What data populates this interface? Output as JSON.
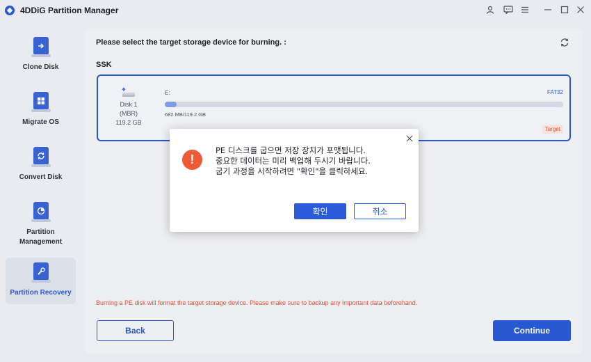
{
  "app": {
    "title": "4DDiG Partition Manager",
    "accent_color": "#2a5ad8",
    "window_controls": [
      "account-icon",
      "feedback-icon",
      "menu-icon",
      "minimize-icon",
      "maximize-icon",
      "close-icon"
    ]
  },
  "sidebar": {
    "items": [
      {
        "label": "Clone Disk",
        "icon": "clone-disk-icon",
        "active": false
      },
      {
        "label": "Migrate OS",
        "icon": "migrate-os-icon",
        "active": false
      },
      {
        "label": "Convert Disk",
        "icon": "convert-disk-icon",
        "active": false
      },
      {
        "label": "Partition\nManagement",
        "icon": "partition-management-icon",
        "active": false
      },
      {
        "label": "Partition Recovery",
        "icon": "partition-recovery-icon",
        "active": true
      }
    ]
  },
  "main": {
    "heading": "Please select the target storage device for burning. :",
    "section": "SSK",
    "disk": {
      "name": "Disk 1",
      "type": "(MBR)",
      "size": "119.2 GB",
      "drive_letter": "E:",
      "filesystem": "FAT32",
      "usage_text": "682 MB/119.2 GB",
      "usage_fraction": 0.03,
      "target_label": "Target"
    },
    "warning": "Burning a PE disk will format the target storage device. Please make sure to backup any important data beforehand.",
    "back_label": "Back",
    "continue_label": "Continue"
  },
  "dialog": {
    "line1": "PE 디스크를 굽으면 저장 장치가 포맷됩니다.",
    "line2": "중요한 데이터는 미리 백업해 두시기 바랍니다.",
    "line3": "굽기 과정을 시작하려면 \"확인\"을 클릭하세요.",
    "ok_label": "확인",
    "cancel_label": "취소"
  }
}
